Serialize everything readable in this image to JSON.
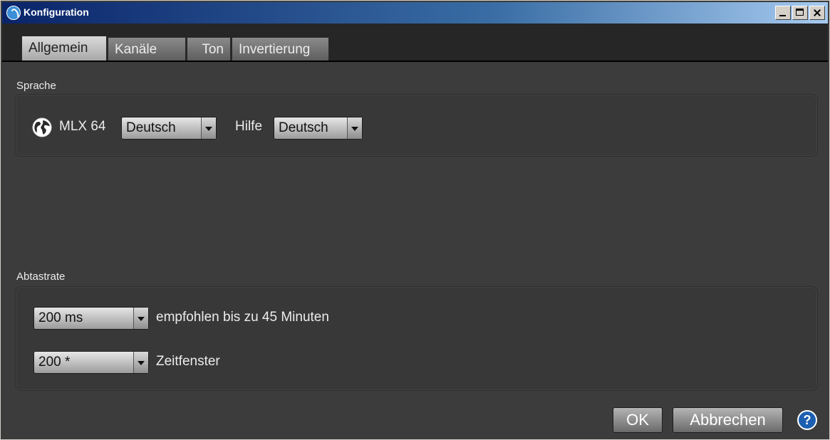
{
  "window": {
    "title": "Konfiguration"
  },
  "tabs": [
    "Allgemein",
    "Kanäle",
    "Ton",
    "Invertierung"
  ],
  "sprache": {
    "label": "Sprache",
    "app_name": "MLX 64",
    "app_language": "Deutsch",
    "help_label": "Hilfe",
    "help_language": "Deutsch"
  },
  "abtastrate": {
    "label": "Abtastrate",
    "rate_value": "200 ms",
    "rate_note": "empfohlen bis zu 45 Minuten",
    "window_value": "200 *",
    "window_note": "Zeitfenster"
  },
  "buttons": {
    "ok": "OK",
    "cancel": "Abbrechen",
    "help_glyph": "?"
  },
  "icons": {
    "app": "app-logo-icon",
    "globe": "globe-icon",
    "help": "help-icon"
  }
}
